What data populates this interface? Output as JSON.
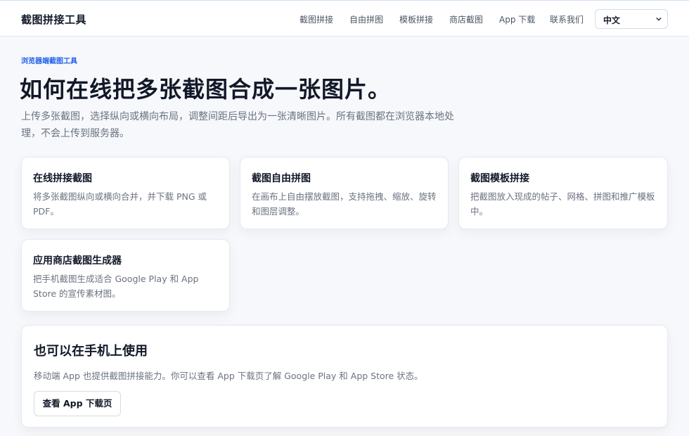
{
  "header": {
    "brand": "截图拼接工具",
    "nav": [
      "截图拼接",
      "自由拼图",
      "模板拼接",
      "商店截图",
      "App 下载",
      "联系我们"
    ],
    "language": "中文",
    "language_icon": "chevron-down-icon"
  },
  "hero": {
    "eyebrow": "浏览器端截图工具",
    "title": "如何在线把多张截图合成一张图片。",
    "subtitle": "上传多张截图，选择纵向或横向布局，调整间距后导出为一张清晰图片。所有截图都在浏览器本地处理，不会上传到服务器。"
  },
  "cards": [
    {
      "title": "在线拼接截图",
      "desc": "将多张截图纵向或横向合并，并下载 PNG 或 PDF。"
    },
    {
      "title": "截图自由拼图",
      "desc": "在画布上自由摆放截图，支持拖拽、缩放、旋转和图层调整。"
    },
    {
      "title": "截图模板拼接",
      "desc": "把截图放入现成的帖子、网格、拼图和推广模板中。"
    },
    {
      "title": "应用商店截图生成器",
      "desc": "把手机截图生成适合 Google Play 和 App Store 的宣传素材图。"
    }
  ],
  "mobile": {
    "title": "也可以在手机上使用",
    "desc": "移动端 App 也提供截图拼接能力。你可以查看 App 下载页了解 Google Play 和 App Store 状态。",
    "button": "查看 App 下载页"
  },
  "colors": {
    "accent": "#2563eb",
    "background": "#f6f8fb",
    "text": "#111827",
    "muted": "#6b7280"
  }
}
